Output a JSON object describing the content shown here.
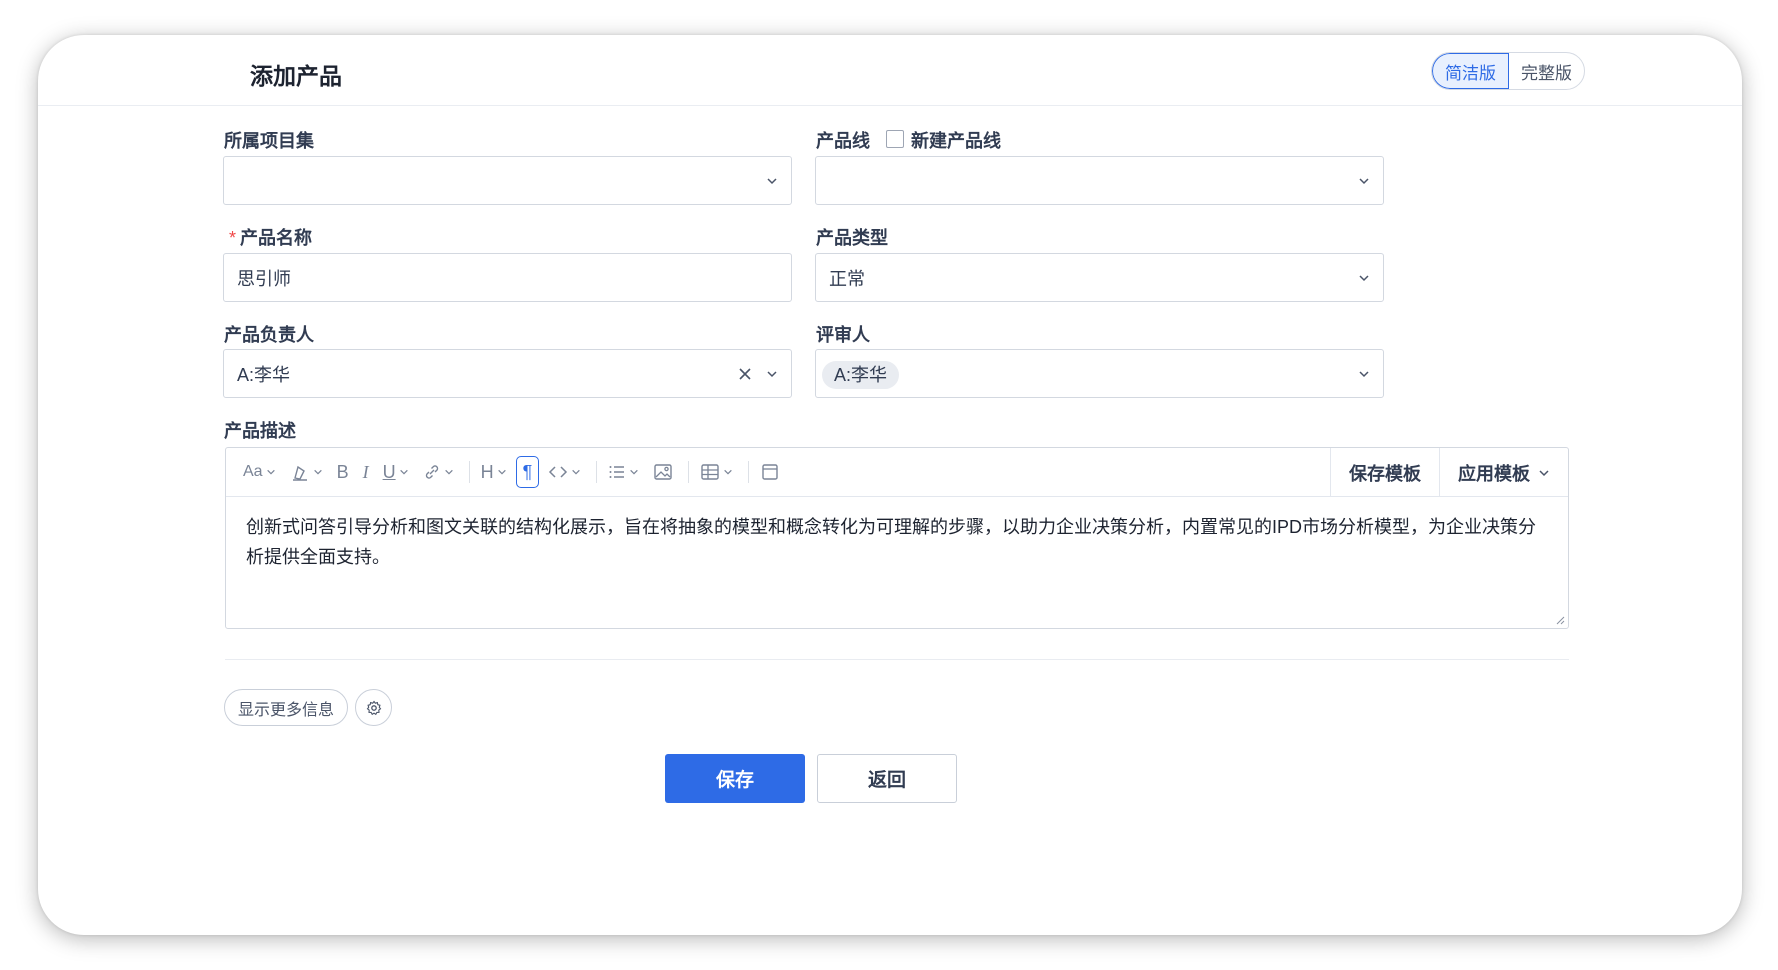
{
  "page": {
    "title": "添加产品",
    "mode_simple": "简洁版",
    "mode_full": "完整版"
  },
  "form": {
    "program_set": {
      "label": "所属项目集",
      "value": ""
    },
    "product_line": {
      "label": "产品线",
      "new_line_label": "新建产品线",
      "new_line_checked": false,
      "value": ""
    },
    "product_name": {
      "required_mark": "*",
      "label": "产品名称",
      "value": "思引师"
    },
    "product_type": {
      "label": "产品类型",
      "value": "正常"
    },
    "product_owner": {
      "label": "产品负责人",
      "value": "A:李华"
    },
    "reviewer": {
      "label": "评审人",
      "chip": "A:李华"
    },
    "description": {
      "label": "产品描述",
      "save_template": "保存模板",
      "apply_template": "应用模板",
      "text": "创新式问答引导分析和图文关联的结构化展示，旨在将抽象的模型和概念转化为可理解的步骤，以助力企业决策分析，内置常见的IPD市场分析模型，为企业决策分析提供全面支持。"
    }
  },
  "toolbar": {
    "font_size_icon": "Aa",
    "heading_icon": "H",
    "paragraph_icon": "¶",
    "bold_icon": "B",
    "italic_icon": "I",
    "underline_icon": "U"
  },
  "footer": {
    "more_info": "显示更多信息",
    "save": "保存",
    "back": "返回"
  },
  "colors": {
    "primary": "#2e6be6",
    "required": "#f04848"
  }
}
